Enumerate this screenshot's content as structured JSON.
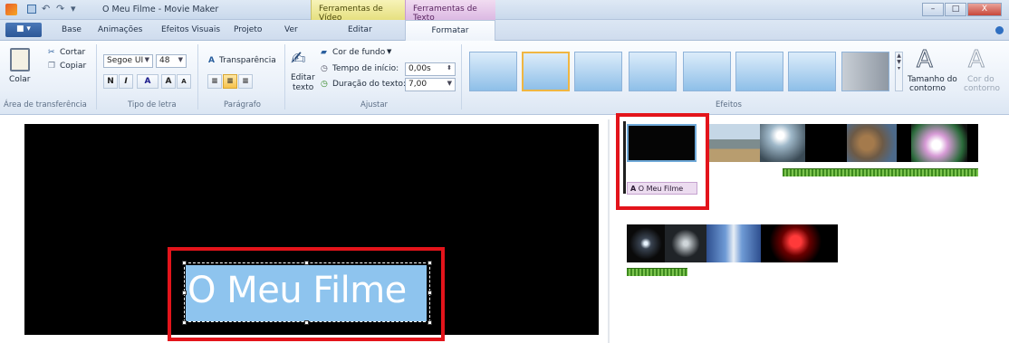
{
  "window": {
    "title": "O Meu Filme - Movie Maker",
    "context_tabs": [
      "Ferramentas de Vídeo",
      "Ferramentas de Texto"
    ],
    "controls": [
      "–",
      "□",
      "X"
    ]
  },
  "tabs": {
    "file_label": "■ ▾",
    "items": [
      "Base",
      "Animações",
      "Efeitos Visuais",
      "Projeto",
      "Ver",
      "Editar",
      "Formatar"
    ],
    "active": "Formatar"
  },
  "clipboard": {
    "paste": "Colar",
    "cut": "Cortar",
    "copy": "Copiar",
    "group": "Área de transferência"
  },
  "font": {
    "family": "Segoe UI",
    "size": "48",
    "bold": "N",
    "italic": "I",
    "color": "A",
    "grow": "A",
    "shrink": "A",
    "group": "Tipo de letra"
  },
  "paragraph": {
    "transparency": "Transparência",
    "group": "Parágrafo"
  },
  "adjust": {
    "edit_text_line1": "Editar",
    "edit_text_line2": "texto",
    "bg_color": "Cor de fundo",
    "start_time_label": "Tempo de início:",
    "start_time_value": "0,00s",
    "duration_label": "Duração do texto:",
    "duration_value": "7,00",
    "group": "Ajustar"
  },
  "effects": {
    "group": "Efeitos",
    "outline_size_line1": "Tamanho do",
    "outline_size_line2": "contorno",
    "outline_color_line1": "Cor do",
    "outline_color_line2": "contorno",
    "selected_index": 1
  },
  "preview": {
    "overlay_text": "O Meu Filme"
  },
  "storyboard": {
    "caption_label": "O Meu Filme",
    "caption_icon": "A"
  },
  "colors": {
    "highlight": "#e3141b",
    "text_selection": "#8ec4ee",
    "ribbon_selected": "#f0b641"
  }
}
